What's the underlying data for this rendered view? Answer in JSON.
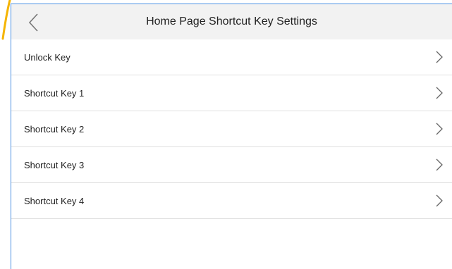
{
  "header": {
    "title": "Home Page Shortcut Key Settings"
  },
  "items": [
    {
      "label": "Unlock Key"
    },
    {
      "label": "Shortcut Key 1"
    },
    {
      "label": "Shortcut Key 2"
    },
    {
      "label": "Shortcut Key 3"
    },
    {
      "label": "Shortcut Key 4"
    }
  ],
  "icons": {
    "back": "chevron-left-icon",
    "row": "chevron-right-icon"
  },
  "colors": {
    "frame_border": "#4a90e2",
    "accent_line": "#f5b400",
    "header_bg": "#f2f2f2"
  }
}
